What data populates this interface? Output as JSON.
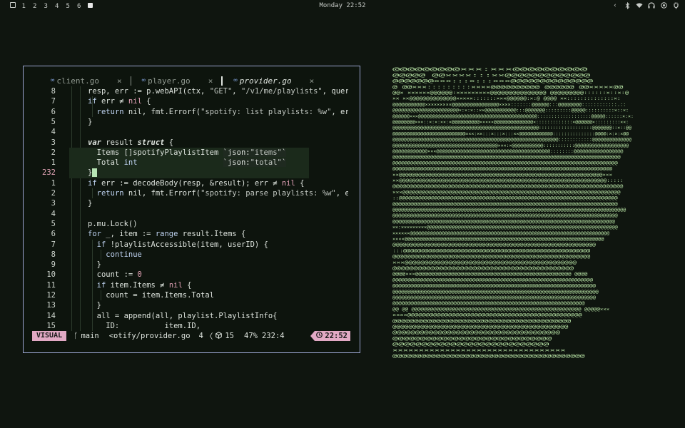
{
  "topbar": {
    "workspaces": [
      "1",
      "2",
      "3",
      "4",
      "5",
      "6"
    ],
    "clock": "Monday 22:52",
    "tray_icons": [
      "chevron-left-icon",
      "bluetooth-icon",
      "wifi-icon",
      "headphones-icon",
      "record-icon",
      "power-icon"
    ]
  },
  "editor": {
    "tabs": [
      {
        "name": "client.go",
        "icon": "go-icon",
        "close": "×"
      },
      {
        "name": "player.go",
        "icon": "go-icon",
        "close": "×"
      },
      {
        "name": "provider.go",
        "icon": "go-icon",
        "close": "×",
        "active": true
      }
    ],
    "lines": [
      {
        "n": "8",
        "code": "resp, err := p.webAPI(ctx, \"GET\", \"/v1/me/playlists\", quer"
      },
      {
        "n": "7",
        "code": "if err ≠ nil {"
      },
      {
        "n": "6",
        "code": "  return nil, fmt.Errorf(\"spotify: list playlists: %w\", er"
      },
      {
        "n": "5",
        "code": "}"
      },
      {
        "n": "4",
        "code": ""
      },
      {
        "n": "3",
        "code": "var result struct {"
      },
      {
        "n": "2",
        "code": "  Items []spotifyPlaylistItem `json:\"items\"`"
      },
      {
        "n": "1",
        "code": "  Total int                   `json:\"total\"`"
      },
      {
        "n": "232",
        "code": "}"
      },
      {
        "n": "1",
        "code": "if err := decodeBody(resp, &result); err ≠ nil {"
      },
      {
        "n": "2",
        "code": "  return nil, fmt.Errorf(\"spotify: parse playlists: %w\", e"
      },
      {
        "n": "3",
        "code": "}"
      },
      {
        "n": "4",
        "code": ""
      },
      {
        "n": "5",
        "code": "p.mu.Lock()"
      },
      {
        "n": "6",
        "code": "for _, item := range result.Items {"
      },
      {
        "n": "7",
        "code": "  if !playlistAccessible(item, userID) {"
      },
      {
        "n": "8",
        "code": "    continue"
      },
      {
        "n": "9",
        "code": "  }"
      },
      {
        "n": "10",
        "code": "  count := 0"
      },
      {
        "n": "11",
        "code": "  if item.Items ≠ nil {"
      },
      {
        "n": "12",
        "code": "    count = item.Items.Total"
      },
      {
        "n": "13",
        "code": "  }"
      },
      {
        "n": "14",
        "code": "  all = append(all, playlist.PlaylistInfo{"
      },
      {
        "n": "15",
        "code": "    ID:          item.ID,"
      }
    ],
    "status": {
      "mode": "VISUAL",
      "branch": "main",
      "file": "<otify/provider.go",
      "col": "4",
      "diagnostics": "15",
      "percent": "47%",
      "position": "232:4",
      "time": "22:52"
    }
  },
  "colors": {
    "background": "#0f150f",
    "border": "#9aa4cf",
    "mode_bg": "#e1a9c4",
    "ascii": "#b7e2a4"
  },
  "ascii_art": {
    "rows": [
      "                           @@@@@@@@@×××:×××@@@@@@@@@@                  ",
      "                          @@@@@  @@××××:::××@@@@@@@@@@@@@               ",
      "                         @@@@@@@×××:::×:::×××@@@@@@@@@@@@@@              ",
      "                     @       @@×××:::::::::××××@@@@@@@@@@       @@@@@@ @@×××××@@    ",
      "                 @@× ××××××@@@@@@:×××××××××@@@@@@@@@@@@@@@   @@@@@@@@@::::::×::×:@    ",
      "          ×× ××@@@@@@@@@@@@@@×××××:::::::×××@@@@@@:×:@  @@@@ ××::::::::::::::×:    ",
      "      @@@@@@@@@@@×××××××××@@@@@@@@@@@@@@@@××××:::::::@@@@@@:::@@@@@@@@::::::::::::.::",
      "    @@@@@@@@@@@@@@@@@@@@@@@×:×:×::××@@@@@@@@@@@:::@@@@@@@:::::::::@@@@@::::::::::×::×:",
      "   @@@@@@×××@@@@@@@@@@@@@@@@@@@@@@@@@@@@@@@@@@@@@@@@@@:::::::::::::::::::@@@@@::::::×:×:",
      "  @@@@@@@@×××::×:×:××:×@@@@@@@@@@×××××@@@@@@@@@@@@@@×:::::::::::::×@@@@@@×:::::::::××:",
      "  @@@@@@@@@@@@@@@@@@@@@@@@@@@@@@@@@@@@@@@@@@@@@@@@@@@@:::::::::::::::::::@@@@@@@::×::@@",
      "  @@@@@@@@@@@@@@@@@@@@@@@@@@×××:××:::×:::×:::××@@@@@@@@@@@@:::::::::::::::@@@@:×:×:×@@",
      "  @@@@@@@@@@@@@@@@@@@@@@@@@@@@@@@@@@@@@@@@@@@@@@@@@@@@@@@@@@@::::::::::::@@@@@@@@@@@@@@",
      "   @@@@@@@@@@@@@@@@@@@@@@@@@@@@@@@@@@@@@×××:×@@@@@@@@@@@:::::::::::@@@@@@@@@@@@@@@@@@@",
      "     @@@@@@@@@@@@×××@@@@@@@@@@@@@@@@@@@@@@@@@@@@@@@@@@@@@@@::::::::@@@@@@@@@@@@@@@@@",
      "     @@@@@@@@@@@@@@@@@@@@@@@@@@@@@@@@@@@@@@@@@@@@@@@@@@@@@@@@@@@@@@@@@@@@@@@@@@@@@@",
      "       @@@@@@@@@@@@@@@@@@@@@@@@@@@@@@@@@@@@@@@@@@@@@@@@@@@@@@@@@@@@@@@@@@@@@@@@@@@",
      "         @@@@@@@@@@@@@@@@@@@@@@@@@@@@@@@@@@@@@@@@@@@@@@@@@@@@@@@@@@@@@@@@@@@@@@@",
      "            ××@@@@@@@@@@@@@@@@@@@@@@@@@@@@@@@@@@@@@@@@@@@@@@@@@@@@@@@@@@@@@@@×××",
      "              ××@@@@@@@@@@@@@@@@@@@@@@@@@@@@@@@@@@@@@@@@@@@@@@@@@@@@@@@@@@@@@@@:::::",
      "                 @@@@@@@@@@@@@@@@@@@@@@@@@@@@@@@@@@@@@@@@@@@@@@@@@@@@@@@@@@@@@@@@@@@",
      "              ×××@@@@@@@@@@@@@@@@@@@@@@@@@@@@@@@@@@@@@@@@@@@@@@@@@@@@@@@@@@@@@@@@@@",
      "            ::@@@@@@@@@@@@@@@@@@@@@@@@@@@@@@@@@@@@@@@@@@@@@@@@@@@@@@@@@@@@@@@@@@@@",
      "        @@@@@@@@@@@@@@@@@@@@@@@@@@@@@@@@@@@@@@@@@@@@@@@@@@@@@@@@@@@@@@@@@@@@@@@@@@",
      "   @@@@@@@@@@@@@@@@@@@@@@@@@@@@@@@@@@@@@@@@@@@@@@@@@@@@@@@@@@@@@@@@@@@@@@@@@@@@@@@@@@",
      "      @@@@@@@@@@@@@@@@@@@@@@@@@@@@@@@@@@@@@@@@@@@@@@@@@@@@@@@@@@@@@@@@@@@@@@@@@@@@",
      "         @@@@@@@@@@@@@@@@@@@@@@@@@@@@@@@@@@@@@@@@@@@@@@@@@@@@@@@@@@@@@@@@@@@@@@@@",
      "   ××:×××××××××@@@@@@@@@@@@@@@@@@@@@@@@@@@@@@@@@@@@@@@@@@@@@@@@@@@@@@@@@@@@@@@@@@@",
      "    ××××××@@@@@@@@@@@@@@@@@@@@@@@@@@@@@@@@@@@@@@@@@@@@@@@@@@@@@@@@@@@@@@@@@@@@@",
      "      ××××@@@@@@@@@@@@@@@@@@@@@@@@@@@@@@@@@@@@@@@@@@@@@@@@@@@@@@@@@@@@@@@@@@@",
      "               @@@@@@@@@@@@@@@@@@@@@@@@@@@@@@@@@@@@@@@@@@@@@@@@@@@@@@@@@@@",
      "                 :::@@@@@@@@@@@@@@@@@@@@@@@@@@@@@@@@@@@@@@@@@@@@@@@@@@@@",
      "                  @@@@@@@@@@@@@@@@@@@@@@@@@@@@@@@@@@@@@@@@@@@@@@@@@@@@@@",
      "                     ×××@@@@@@@@@@@@@@@@@@@@@@@@@@@@@@@@@@@@@@@@@@@",
      "                       @@@@@@@@@@@@@@@@@@@@@@@@@@@@@@@@@@@@@@@@@@@",
      "          @@@@×××@@@@@@@@@@@@@@@@@@@@@@@@@@@@@@@@@@@@@@@@@@@@@@@@  @@@@",
      "        @@@@@@@@@@@@@@@@@@@@@@@@@@@@@@@@@@@@@@@@@@@@@@@@@@@@@@@@@@@@@@@@@",
      "       @@@@@@@@@@@@@@@@@@@@@@@@@@@@@@@@@@@@@@@@@@@@@@@@@@@@@@@@@@@@@@@@@@@",
      "     @@@@@@@@@@@@@@@@@@@@@@@@@@@@@@@@@@@@@@@@@@@@@@@@@@@@@@@@@@@@@@@@@@@@@@",
      "      @@@@@@@@@@@@@@@@@@@@@@@@@@@@@@@@@@@@@@@@@@@@@@@@@@@@@@@@@@@@@@@@@@@@",
      "       @@@@@@@@@@@@@@@@@@@@@@@@@@@@@@@@@@@@@@@@@@@@@@@@@@@@@@@@@@@@@@@",
      "  @@ @@      @@@@@@@@@@@@@@@@@@@@@@@@@@@@@@@@@@@@@@@@@@@@@@@@@@@@@@    @@@@@×××",
      "                  ××××@@@@@@@@@@@@@@@@@@@@@@@@@@@@@@@@@@@@@@@@@@@@@@@",
      "                        @@@@@@@@@@@@@@@@@@@@@@@@@@@@@@@@@@@@@@@@@",
      "                    @@@@@@@@@@@@@@@@@@@@@@@@@@@@@@@@@@@@@@@@@@@@",
      "                        @@@@@@@@@@@@@@@@@@@@@@@@@@@@@@@@@@@@@",
      "                             @@@@@@@@@@@@@@@@@@@@@@@@@@@@@",
      "                              @@@@@@@@@@@@@@@@@@@@@@@@@@@",
      "                              ×××××××××××××××××××××××××××××××××",
      "                              @@@@@@@@@@@@@@@@@@@@@@@@@@@@@@@@@@@@@@@@"
    ]
  }
}
